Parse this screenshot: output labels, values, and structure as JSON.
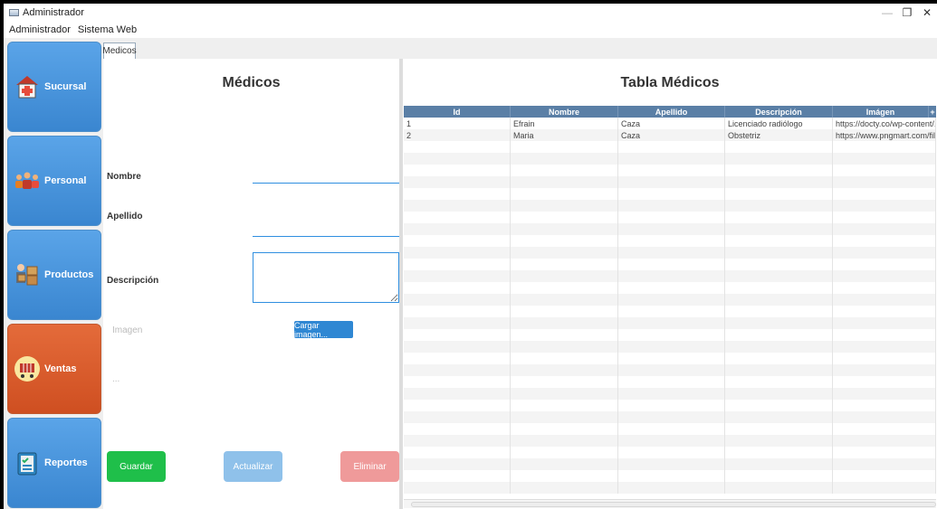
{
  "window": {
    "title": "Administrador",
    "close_glyph": "✕",
    "max_glyph": "❐",
    "min_glyph": "—"
  },
  "menu": [
    "Administrador",
    "Sistema Web"
  ],
  "sidebar": {
    "items": [
      {
        "label": "Sucursal",
        "icon": "hospital-icon",
        "color": "#3a86d0"
      },
      {
        "label": "Personal",
        "icon": "people-icon",
        "color": "#3a86d0"
      },
      {
        "label": "Productos",
        "icon": "boxes-icon",
        "color": "#3a86d0"
      },
      {
        "label": "Ventas",
        "icon": "cart-icon",
        "color": "#cf4f21"
      },
      {
        "label": "Reportes",
        "icon": "clipboard-icon",
        "color": "#3a86d0"
      }
    ]
  },
  "tab": {
    "label": "Medicos"
  },
  "form": {
    "title": "Médicos",
    "nombre_label": "Nombre",
    "apellido_label": "Apellido",
    "descripcion_label": "Descripción",
    "imagen_label": "Imagen",
    "placeholder_dots": "...",
    "upload_button": "Cargar imagen...",
    "save_button": "Guardar",
    "update_button": "Actualizar",
    "delete_button": "Eliminar"
  },
  "table": {
    "title": "Tabla Médicos",
    "columns": [
      "Id",
      "Nombre",
      "Apellido",
      "Descripción",
      "Imágen"
    ],
    "rows": [
      [
        "1",
        "Efrain",
        "Caza",
        "Licenciado radiólogo",
        "https://docty.co/wp-content/..."
      ],
      [
        "2",
        "Maria",
        "Caza",
        "Obstetriz",
        "https://www.pngmart.com/file..."
      ]
    ],
    "corner_glyph": "+"
  },
  "colors": {
    "accent": "#2f8fe0",
    "save": "#1fbf4a",
    "update": "#8fc1ea",
    "delete": "#ef9a9a",
    "header": "#5a7fa6",
    "nav_blue": "#3a86d0",
    "nav_orange": "#cf4f21"
  }
}
